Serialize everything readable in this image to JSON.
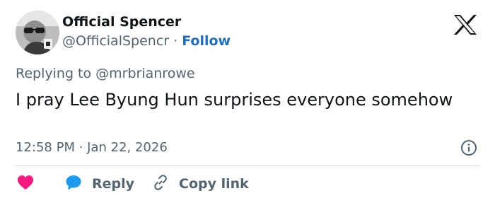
{
  "author": {
    "display_name": "Official Spencer",
    "handle": "@OfficialSpencr",
    "separator": " · ",
    "follow_label": "Follow"
  },
  "tweet": {
    "replying_to": "Replying to @mrbrianrowe",
    "text": "I pray Lee Byung Hun surprises everyone somehow",
    "time": "12:58 PM",
    "date_separator": " · ",
    "date": "Jan 22, 2026"
  },
  "actions": {
    "reply_label": "Reply",
    "copy_label": "Copy link"
  },
  "icons": {
    "brand": "x-logo-icon",
    "info": "info-icon",
    "like": "heart-icon",
    "reply": "speech-bubble-icon",
    "copy": "link-icon"
  },
  "colors": {
    "follow": "#1d6fc4",
    "heart": "#f91880",
    "reply_bubble": "#1d9bf0",
    "muted": "#536471"
  }
}
